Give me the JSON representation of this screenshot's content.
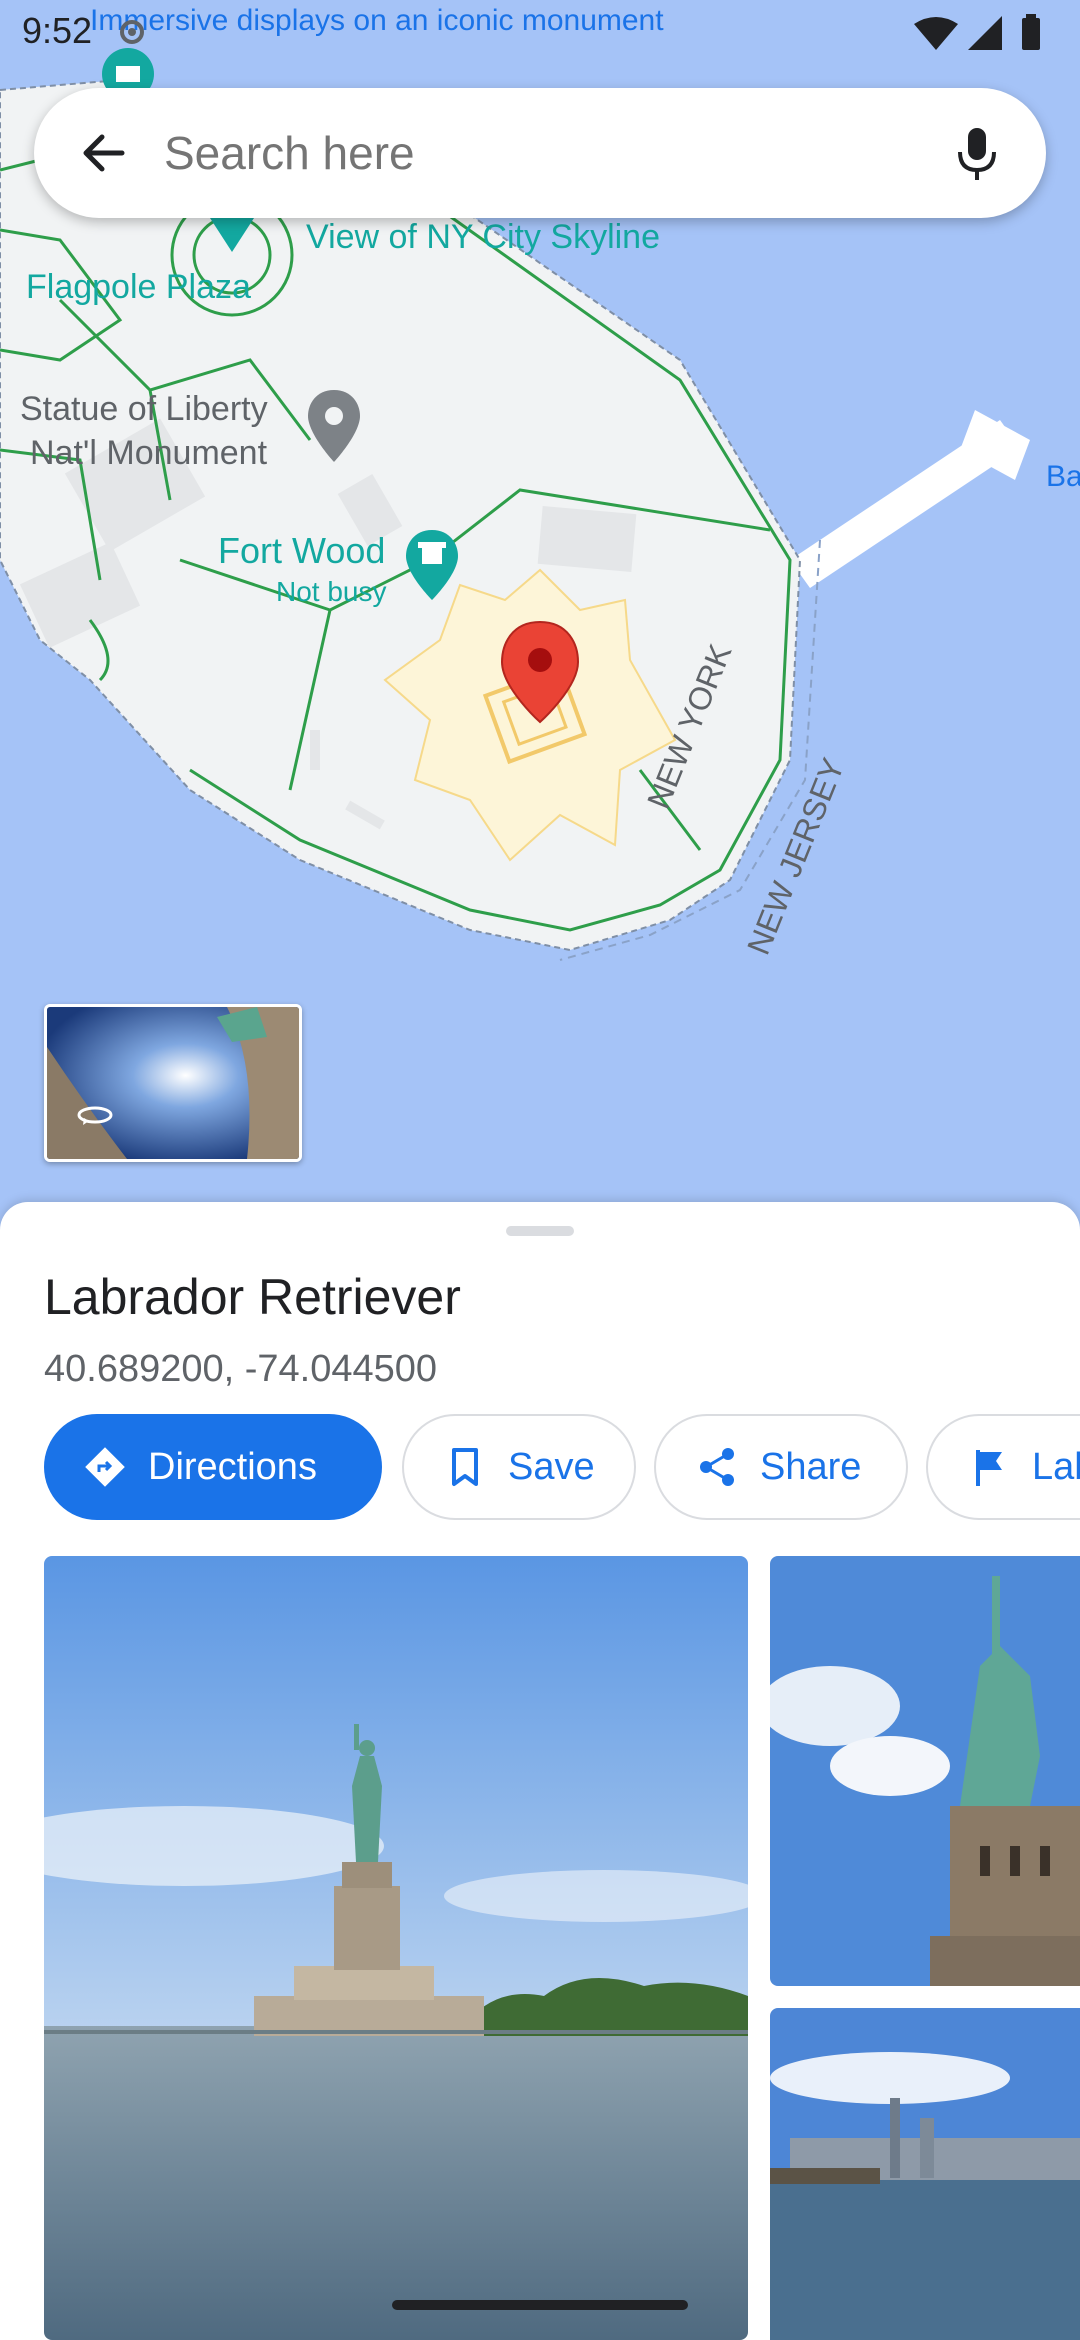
{
  "status_bar": {
    "time": "9:52",
    "banner_text": "Immersive displays on an iconic monument"
  },
  "search": {
    "placeholder": "Search here"
  },
  "map": {
    "labels": {
      "skyline": "View of NY City Skyline",
      "flagpole": "Flagpole Plaza",
      "statue_line1": "Statue of Liberty",
      "statue_line2": "Nat'l Monument",
      "fort_wood": "Fort Wood",
      "fort_status": "Not busy",
      "new_york": "NEW YORK",
      "new_jersey": "NEW JERSEY",
      "edge_partial": "Ba"
    },
    "colors": {
      "water": "#a5c3f7",
      "land": "#f1f3f4",
      "path": "#2e9e4a",
      "pin": "#ea4335",
      "poi": "#13a8a0"
    }
  },
  "place": {
    "title": "Labrador Retriever",
    "coordinates": "40.689200, -74.044500"
  },
  "actions": {
    "directions": "Directions",
    "save": "Save",
    "share": "Share",
    "label": "Label"
  },
  "icons": {
    "back": "arrow-left-icon",
    "mic": "microphone-icon",
    "directions": "directions-diamond-icon",
    "save": "bookmark-icon",
    "share": "share-icon",
    "label": "flag-icon",
    "street_view": "360-rotate-icon"
  }
}
